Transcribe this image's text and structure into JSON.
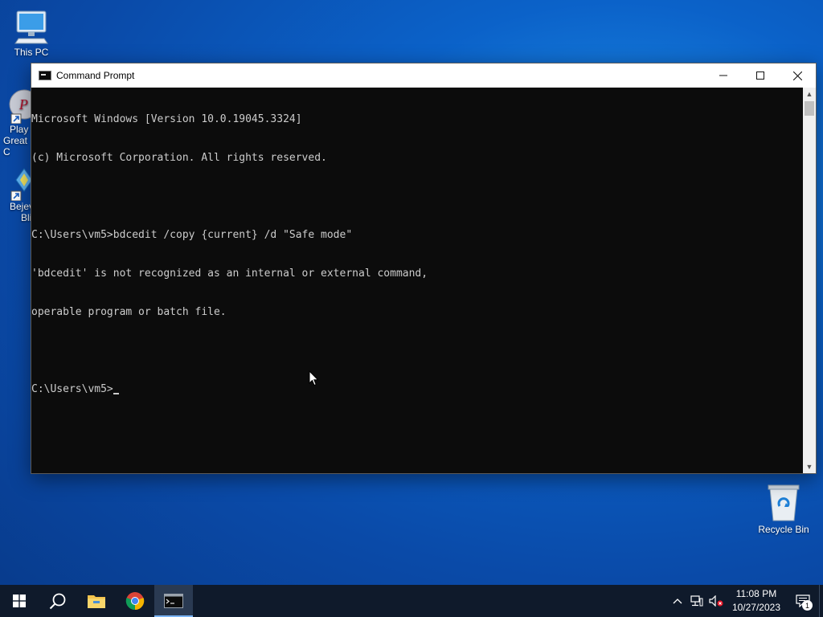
{
  "desktop": {
    "icons": [
      {
        "name": "This PC",
        "icon": "computer-icon"
      },
      {
        "name": "Recycle Bin",
        "icon": "recycle-bin-icon"
      }
    ],
    "clipped_icons": [
      {
        "line1": "Play",
        "line2": "Great C",
        "icon": "game-shortcut-icon"
      },
      {
        "line1": "Bejev",
        "line2": "Bli",
        "icon": "game-shortcut-icon"
      }
    ]
  },
  "window": {
    "title": "Command Prompt",
    "icon": "cmd-icon",
    "controls": {
      "minimize": "minimize-icon",
      "maximize": "maximize-icon",
      "close": "close-icon"
    }
  },
  "console": {
    "lines": [
      "Microsoft Windows [Version 10.0.19045.3324]",
      "(c) Microsoft Corporation. All rights reserved.",
      "",
      "C:\\Users\\vm5>bdcedit /copy {current} /d \"Safe mode\"",
      "'bdcedit' is not recognized as an internal or external command,",
      "operable program or batch file.",
      "",
      "C:\\Users\\vm5>"
    ]
  },
  "taskbar": {
    "apps": [
      {
        "icon": "windows-start-icon"
      },
      {
        "icon": "search-icon"
      },
      {
        "icon": "file-explorer-icon"
      },
      {
        "icon": "chrome-icon"
      },
      {
        "icon": "cmd-icon",
        "active": true
      }
    ],
    "tray": {
      "time": "11:08 PM",
      "date": "10/27/2023",
      "notification_count": "1",
      "icons": [
        "chevron-up-icon",
        "network-icon",
        "volume-muted-icon",
        "notification-icon"
      ]
    }
  },
  "colors": {
    "console_bg": "#0c0c0c",
    "console_fg": "#cccccc",
    "taskbar_bg": "#0f1a2b",
    "accent": "#7ab4f5"
  }
}
